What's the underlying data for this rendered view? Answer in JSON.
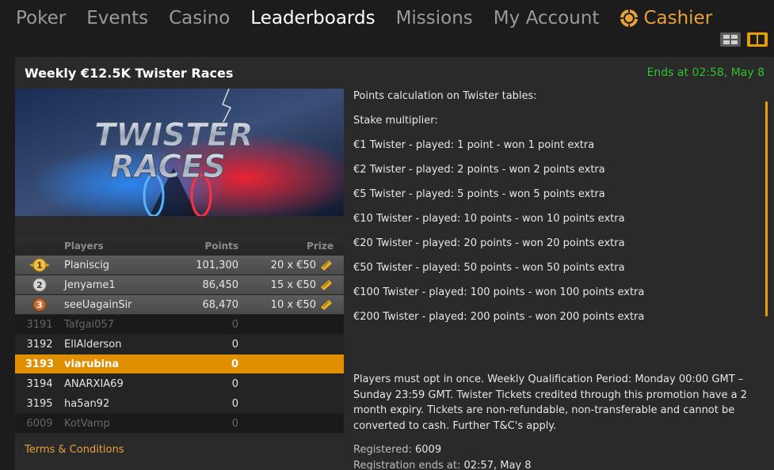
{
  "nav": {
    "items": [
      "Poker",
      "Events",
      "Casino",
      "Leaderboards",
      "Missions",
      "My Account"
    ],
    "active": "Leaderboards",
    "cashier_label": "Cashier"
  },
  "panel": {
    "title": "Weekly €12.5K Twister Races",
    "ends_at": "Ends at 02:58, May 8",
    "banner_title_line1": "TWISTER",
    "banner_title_line2": "RACES"
  },
  "leaderboard": {
    "headers": {
      "players": "Players",
      "points": "Points",
      "prize": "Prize"
    },
    "rows": [
      {
        "rank": "1",
        "player": "Planiscig",
        "points": "101,300",
        "prize": "20 x €50"
      },
      {
        "rank": "2",
        "player": "Jenyame1",
        "points": "86,450",
        "prize": "15 x €50"
      },
      {
        "rank": "3",
        "player": "seeUagainSir",
        "points": "68,470",
        "prize": "10 x €50"
      },
      {
        "rank": "3191",
        "player": "Tafgai057",
        "points": "0",
        "prize": ""
      },
      {
        "rank": "3192",
        "player": "EllAlderson",
        "points": "0",
        "prize": ""
      },
      {
        "rank": "3193",
        "player": "viarubina",
        "points": "0",
        "prize": ""
      },
      {
        "rank": "3194",
        "player": "ANARXIA69",
        "points": "0",
        "prize": ""
      },
      {
        "rank": "3195",
        "player": "ha5an92",
        "points": "0",
        "prize": ""
      },
      {
        "rank": "6009",
        "player": "KotVamp",
        "points": "0",
        "prize": ""
      }
    ]
  },
  "terms_label": "Terms & Conditions",
  "info": {
    "calc_title": "Points calculation on Twister tables:",
    "multiplier_title": "Stake multiplier:",
    "lines": [
      "€1 Twister - played: 1 point - won 1 point extra",
      "€2 Twister - played: 2 points - won 2 points extra",
      "€5 Twister - played: 5 points - won 5 points extra",
      "€10 Twister - played: 10 points - won 10 points extra",
      "€20 Twister - played: 20 points - won 20 points extra",
      "€50 Twister - played: 50 points - won 50 points extra",
      "€100 Twister - played: 100 points - won 100 points extra",
      "€200 Twister - played: 200 points - won 200 points extra"
    ],
    "opt_in": "Players must opt in once. Weekly Qualification Period: Monday 00:00 GMT – Sunday 23:59 GMT. Twister Tickets credited through this promotion have a 2 month expiry. Tickets are non-refundable, non-transferable and cannot be converted to cash. Further T&C's apply.",
    "registered_label": "Registered:",
    "registered_value": "6009",
    "reg_ends_label": "Registration ends at:",
    "reg_ends_value": "02:57, May 8"
  }
}
